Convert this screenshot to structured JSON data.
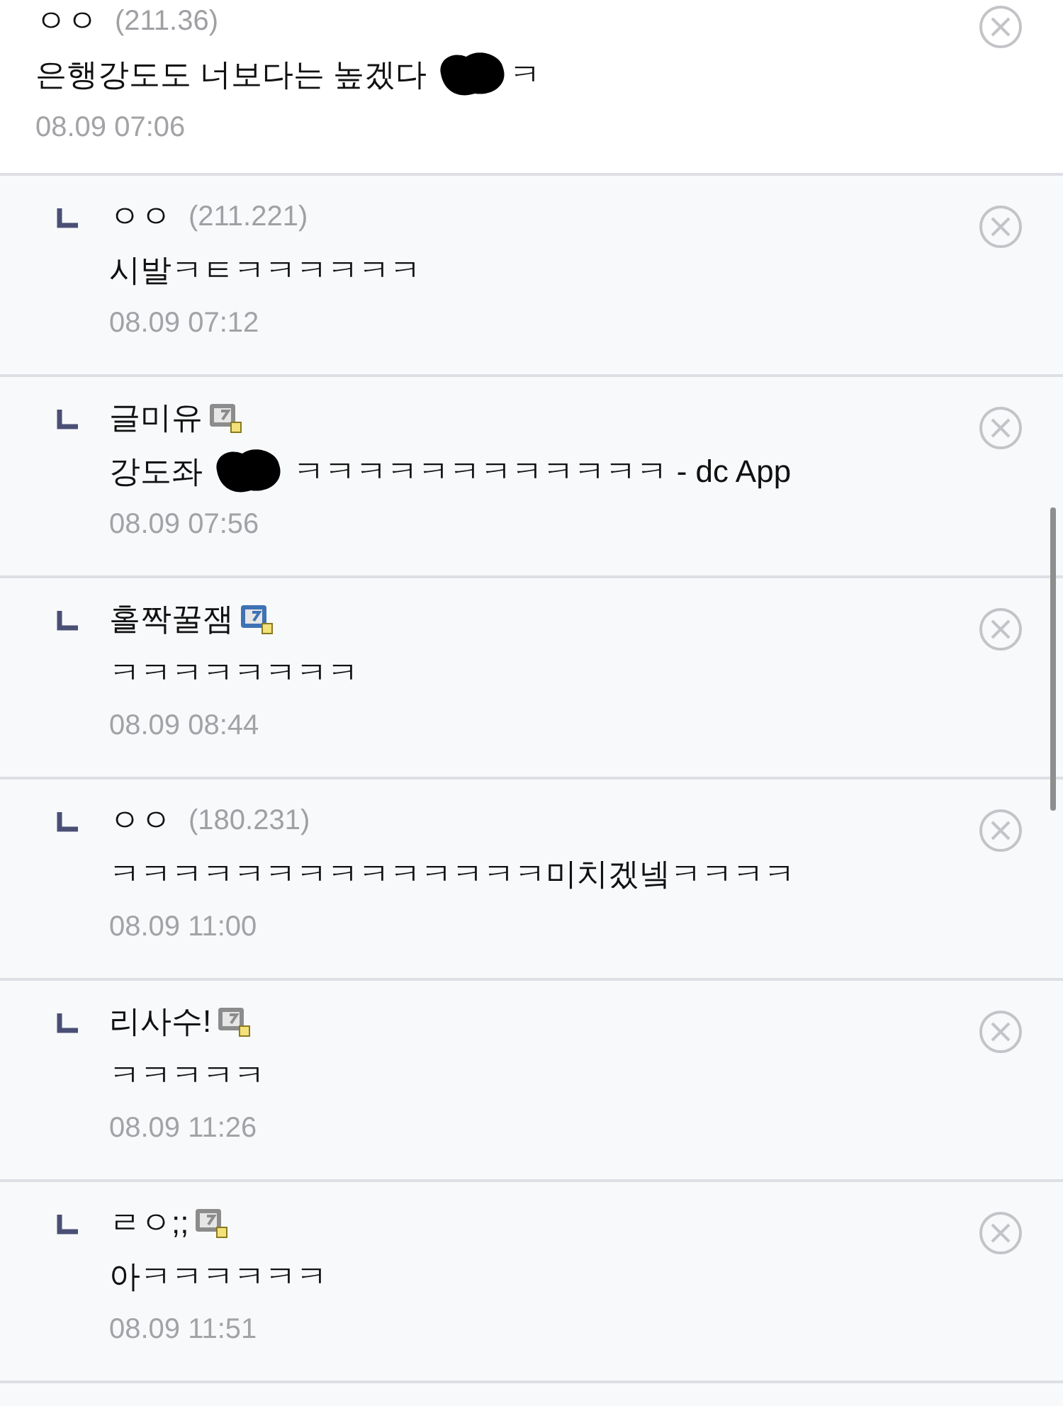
{
  "comments": [
    {
      "reply": false,
      "name": "ㅇㅇ",
      "ip": "(211.36)",
      "body": [
        {
          "kind": "text",
          "text": "은행강도도 너보다는 높겠다 "
        },
        {
          "kind": "redaction"
        },
        {
          "kind": "text",
          "text": "ㅋ"
        }
      ],
      "date": "08.09 07:06"
    },
    {
      "reply": true,
      "name": "ㅇㅇ",
      "ip": "(211.221)",
      "body": [
        {
          "kind": "text",
          "text": "시발ㅋㅌㅋㅋㅋㅋㅋㅋ"
        }
      ],
      "date": "08.09 07:12"
    },
    {
      "reply": true,
      "name": "글미유",
      "badge": {
        "color": "#8c8c8c"
      },
      "body": [
        {
          "kind": "text",
          "text": "강도좌 "
        },
        {
          "kind": "redaction"
        },
        {
          "kind": "text",
          "text": " ㅋㅋㅋㅋㅋㅋㅋㅋㅋㅋㅋㅋ - dc App"
        }
      ],
      "date": "08.09 07:56"
    },
    {
      "reply": true,
      "name": "홀짝꿀잼",
      "badge": {
        "color": "#3f72b5"
      },
      "body": [
        {
          "kind": "text",
          "text": "ㅋㅋㅋㅋㅋㅋㅋㅋ"
        }
      ],
      "date": "08.09 08:44"
    },
    {
      "reply": true,
      "name": "ㅇㅇ",
      "ip": "(180.231)",
      "body": [
        {
          "kind": "text",
          "text": "ㅋㅋㅋㅋㅋㅋㅋㅋㅋㅋㅋㅋㅋㅋ미치겠넼ㅋㅋㅋㅋ"
        }
      ],
      "date": "08.09 11:00"
    },
    {
      "reply": true,
      "name": "리사수!",
      "badge": {
        "color": "#8c8c8c"
      },
      "body": [
        {
          "kind": "text",
          "text": "ㅋㅋㅋㅋㅋ"
        }
      ],
      "date": "08.09 11:26"
    },
    {
      "reply": true,
      "name": "ㄹㅇ;;",
      "badge": {
        "color": "#8c8c8c"
      },
      "body": [
        {
          "kind": "text",
          "text": "아ㅋㅋㅋㅋㅋㅋ"
        }
      ],
      "date": "08.09 11:51"
    }
  ]
}
